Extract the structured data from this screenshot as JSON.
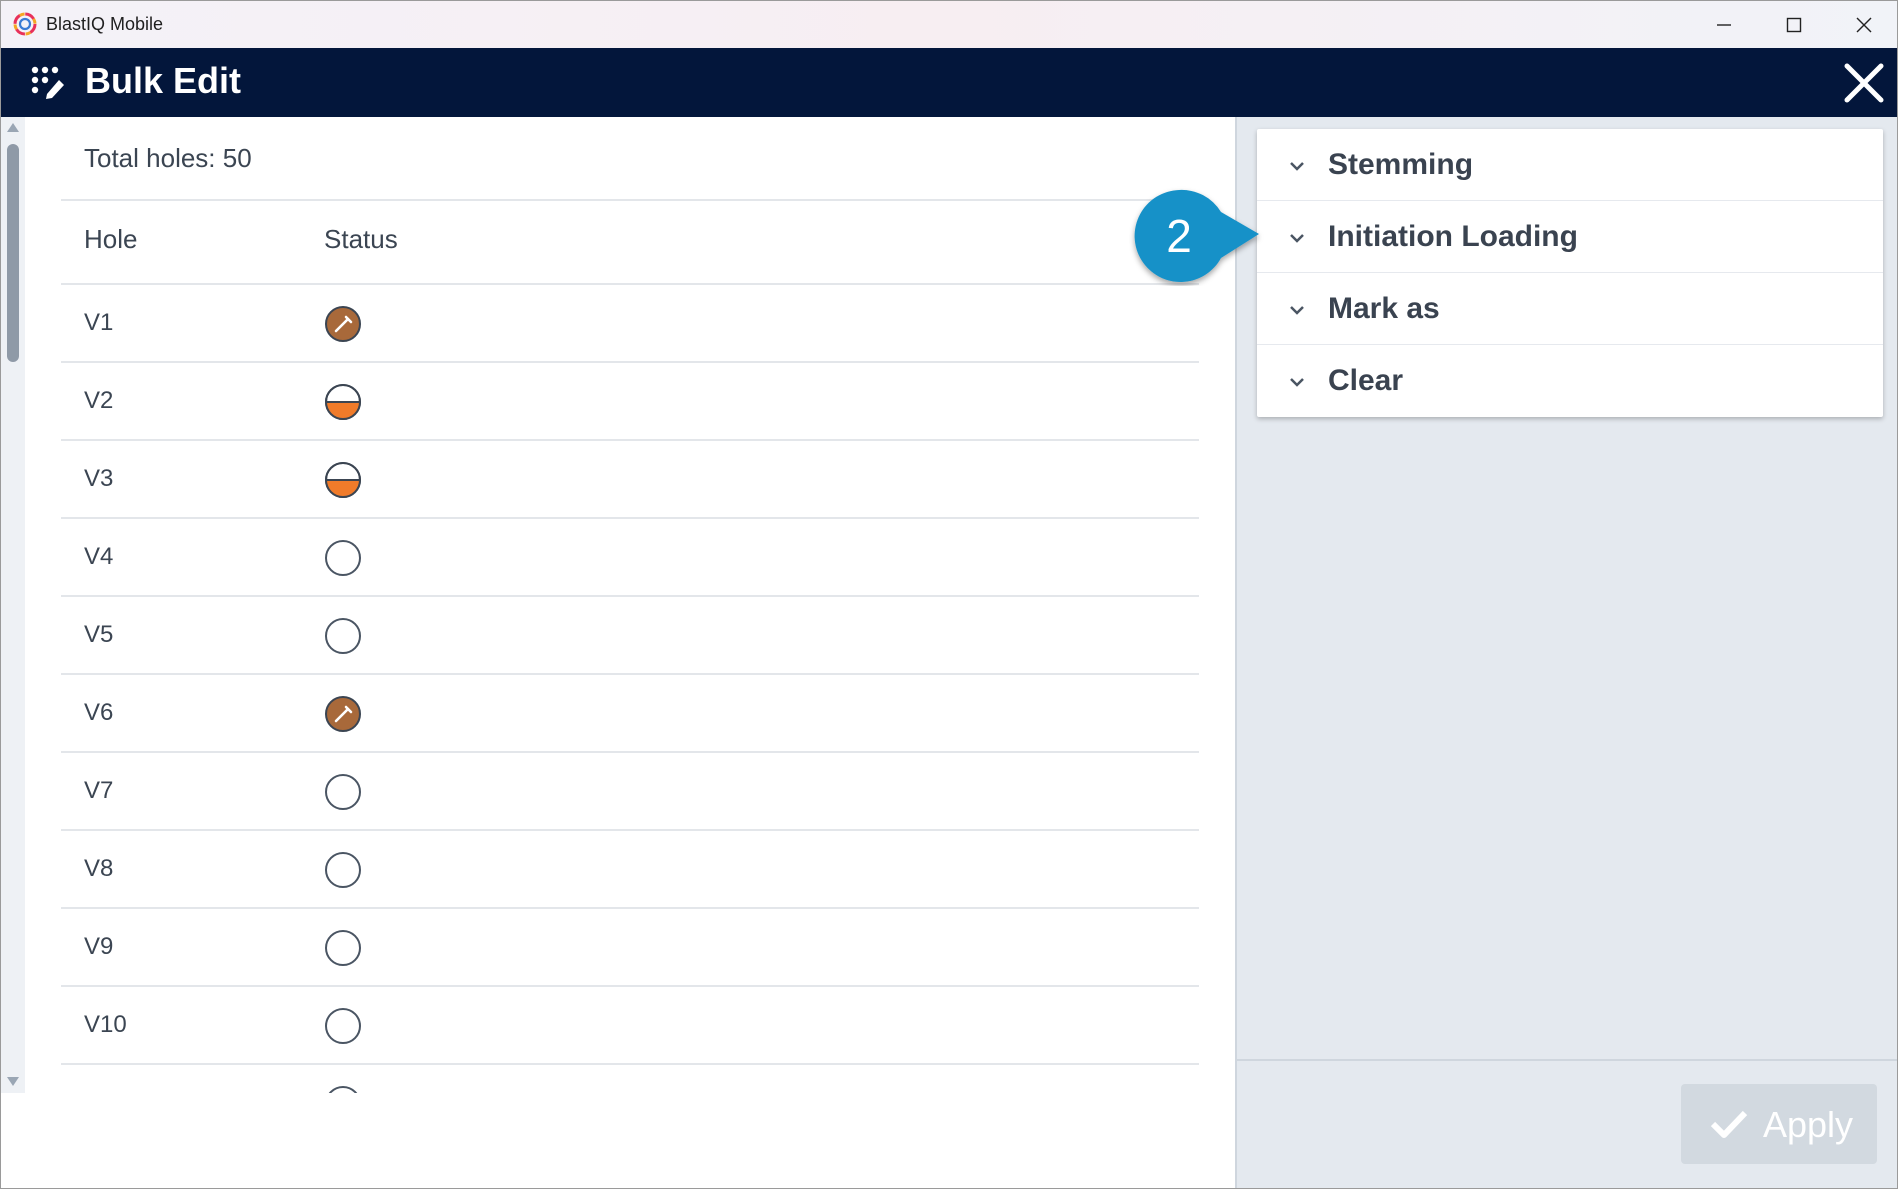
{
  "window": {
    "title": "BlastIQ Mobile",
    "controls": [
      "minimize-icon",
      "maximize-icon",
      "close-icon"
    ]
  },
  "header": {
    "title": "Bulk Edit",
    "menu_icon": "dots-edit-icon",
    "close_icon": "close-icon",
    "background": "#03163b"
  },
  "holes": {
    "total_label": "Total holes: 50",
    "columns": [
      "Hole",
      "Status"
    ],
    "rows": [
      {
        "hole": "V1",
        "status": "drilled"
      },
      {
        "hole": "V2",
        "status": "half-loaded"
      },
      {
        "hole": "V3",
        "status": "half-loaded"
      },
      {
        "hole": "V4",
        "status": "empty"
      },
      {
        "hole": "V5",
        "status": "empty"
      },
      {
        "hole": "V6",
        "status": "drilled"
      },
      {
        "hole": "V7",
        "status": "empty"
      },
      {
        "hole": "V8",
        "status": "empty"
      },
      {
        "hole": "V9",
        "status": "empty"
      },
      {
        "hole": "V10",
        "status": "empty"
      },
      {
        "hole": "",
        "status": "empty"
      }
    ]
  },
  "panel": {
    "sections": [
      {
        "label": "Stemming",
        "icon": "chevron-down-icon"
      },
      {
        "label": "Initiation Loading",
        "icon": "chevron-down-icon"
      },
      {
        "label": "Mark as",
        "icon": "chevron-down-icon"
      },
      {
        "label": "Clear",
        "icon": "chevron-down-icon"
      }
    ],
    "apply_label": "Apply",
    "apply_icon": "check-icon",
    "apply_enabled": false
  },
  "callout": {
    "number": "2",
    "color": "#1591c8"
  },
  "colors": {
    "drilled": "#a8693a",
    "loaded": "#f07b2a",
    "panel_bg": "#e4e9ef"
  }
}
